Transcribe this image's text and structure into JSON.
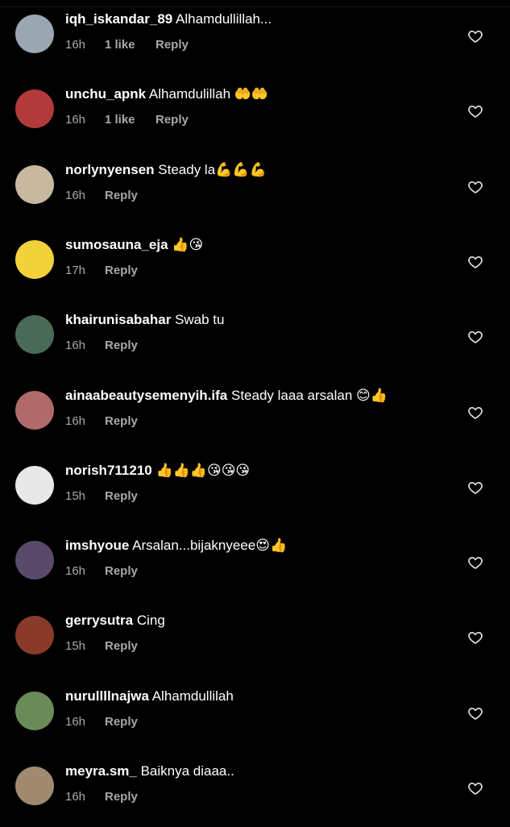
{
  "comments": [
    {
      "username": "iqh_iskandar_89",
      "text": "Alhamdullillah...",
      "time": "16h",
      "likes": "1 like",
      "reply": "Reply",
      "avatar_color": "#9aa6b2"
    },
    {
      "username": "unchu_apnk",
      "text": "Alhamdulillah 🤲🤲",
      "time": "16h",
      "likes": "1 like",
      "reply": "Reply",
      "avatar_color": "#b33a3a"
    },
    {
      "username": "norlynyensen",
      "text": "Steady la💪💪💪",
      "time": "16h",
      "likes": "",
      "reply": "Reply",
      "avatar_color": "#c9b8a0"
    },
    {
      "username": "sumosauna_eja",
      "text": "👍😘",
      "time": "17h",
      "likes": "",
      "reply": "Reply",
      "avatar_color": "#f2d23a"
    },
    {
      "username": "khairunisabahar",
      "text": "Swab tu",
      "time": "16h",
      "likes": "",
      "reply": "Reply",
      "avatar_color": "#4a6a58"
    },
    {
      "username": "ainaabeautysemenyih.ifa",
      "text": "Steady laaa arsalan 😊👍",
      "time": "16h",
      "likes": "",
      "reply": "Reply",
      "avatar_color": "#b06a6a"
    },
    {
      "username": "norish711210",
      "text": "👍👍👍😘😘😘",
      "time": "15h",
      "likes": "",
      "reply": "Reply",
      "avatar_color": "#e8e8e8"
    },
    {
      "username": "imshyoue",
      "text": "Arsalan...bijaknyeee😍👍",
      "time": "16h",
      "likes": "",
      "reply": "Reply",
      "avatar_color": "#5a4a6a"
    },
    {
      "username": "gerrysutra",
      "text": "Cing",
      "time": "15h",
      "likes": "",
      "reply": "Reply",
      "avatar_color": "#8a3a2a"
    },
    {
      "username": "nurullllnajwa",
      "text": "Alhamdullilah",
      "time": "16h",
      "likes": "",
      "reply": "Reply",
      "avatar_color": "#6a8a5a"
    },
    {
      "username": "meyra.sm_",
      "text": "Baiknya diaaa..",
      "time": "16h",
      "likes": "",
      "reply": "Reply",
      "avatar_color": "#a08a70"
    }
  ],
  "icons": {
    "like": "heart-icon"
  }
}
